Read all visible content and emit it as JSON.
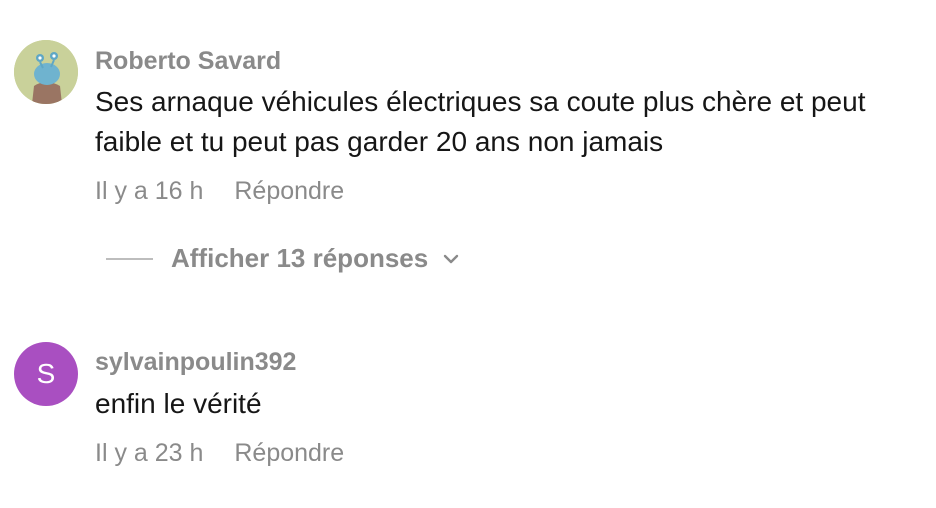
{
  "comments": [
    {
      "username": "Roberto Savard",
      "text": "Ses arnaque véhicules électriques sa coute plus chère et peut faible et tu peut pas garder 20 ans non jamais",
      "time": "Il y a 16 h",
      "reply_label": "Répondre",
      "show_replies_label": "Afficher 13 réponses",
      "avatar_icon": "avatar-photo"
    },
    {
      "username": "sylvainpoulin392",
      "text": "enfin le vérité",
      "time": "Il y a 23 h",
      "reply_label": "Répondre",
      "avatar_letter": "S",
      "avatar_color": "#a94fc1"
    }
  ]
}
